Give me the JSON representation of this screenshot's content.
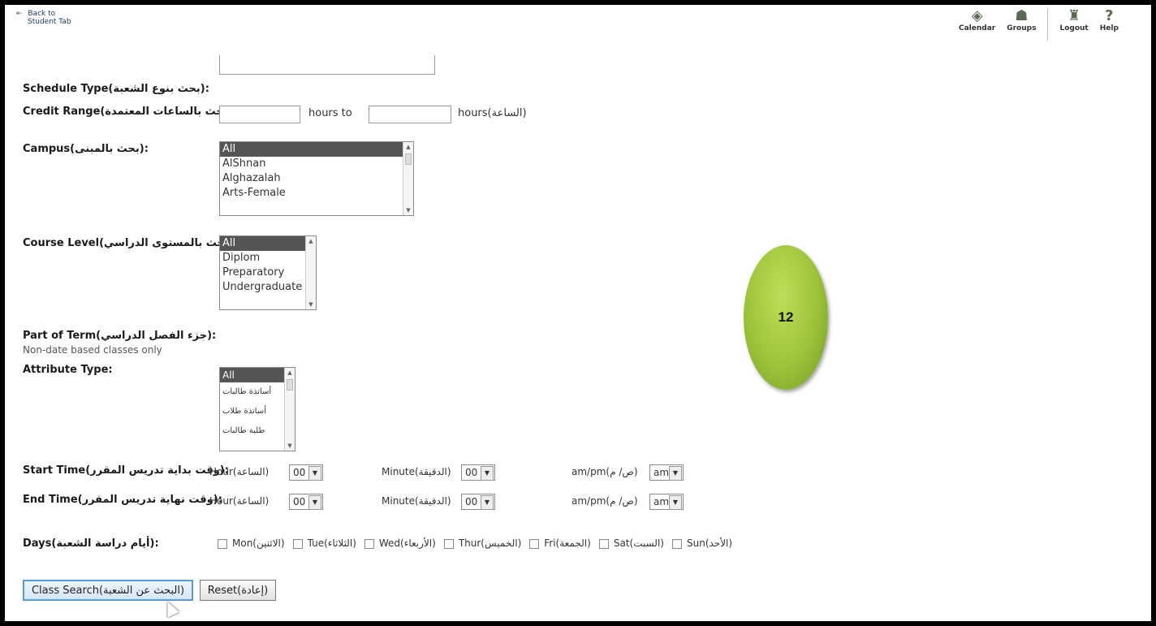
{
  "header": {
    "back_line1": "Back to",
    "back_line2": "Student Tab",
    "nav": [
      {
        "label": "Calendar",
        "icon": "calendar-icon"
      },
      {
        "label": "Groups",
        "icon": "groups-icon"
      },
      {
        "label": "Logout",
        "icon": "logout-icon"
      },
      {
        "label": "Help",
        "icon": "help-icon"
      }
    ]
  },
  "form": {
    "schedule_type": {
      "label": "Schedule Type(بحث بنوع الشعبة):"
    },
    "credit_range": {
      "label": "Credit Range(بحث بالساعات المعتمدة):",
      "hours_to": "hours to",
      "hours": "hours(الساعة)",
      "from_value": "",
      "to_value": ""
    },
    "campus": {
      "label": "Campus(بحث بالمبنى):",
      "options": [
        "All",
        "AlShnan",
        "Alghazalah",
        "Arts-Female"
      ],
      "selected": "All"
    },
    "course_level": {
      "label": "Course Level(بحث بالمستوى الدراسي):",
      "options": [
        "All",
        "Diplom",
        "Preparatory",
        "Undergraduate"
      ],
      "selected": "All"
    },
    "part_of_term": {
      "label": "Part of Term(جزء الفصل الدراسي):",
      "note": "Non-date based classes only"
    },
    "attribute_type": {
      "label": "Attribute Type:",
      "options": [
        "All",
        "أساتذة طالبات",
        "أساتذة طلاب",
        "طلبة طالبات"
      ],
      "selected": "All"
    },
    "start_time": {
      "label": "Start Time(وقت بداية تدريس المقرر):",
      "hour_label": "Hour(الساعة)",
      "hour_value": "00",
      "minute_label": "Minute(الدقيقة)",
      "minute_value": "00",
      "ampm_label": "am/pm(ص/ م)",
      "ampm_value": "am"
    },
    "end_time": {
      "label": "End Time(وقت نهاية تدريس المقرر):",
      "hour_label": "Hour(الساعة)",
      "hour_value": "00",
      "minute_label": "Minute(الدقيقة)",
      "minute_value": "00",
      "ampm_label": "am/pm(ص/ م)",
      "ampm_value": "am"
    },
    "days": {
      "label": "Days(أيام دراسة الشعبة):",
      "items": [
        "Mon(الاثنين)",
        "Tue(الثلاثاء)",
        "Wed(الأربعاء)",
        "Thur(الخميس)",
        "Fri(الجمعة)",
        "Sat(السبت)",
        "Sun(الأحد)"
      ]
    },
    "buttons": {
      "search": "Class Search(البحث عن الشعبة)",
      "reset": "Reset(إعادة)"
    }
  },
  "overlay": {
    "step_number": "12",
    "color": "#9cc23a"
  }
}
